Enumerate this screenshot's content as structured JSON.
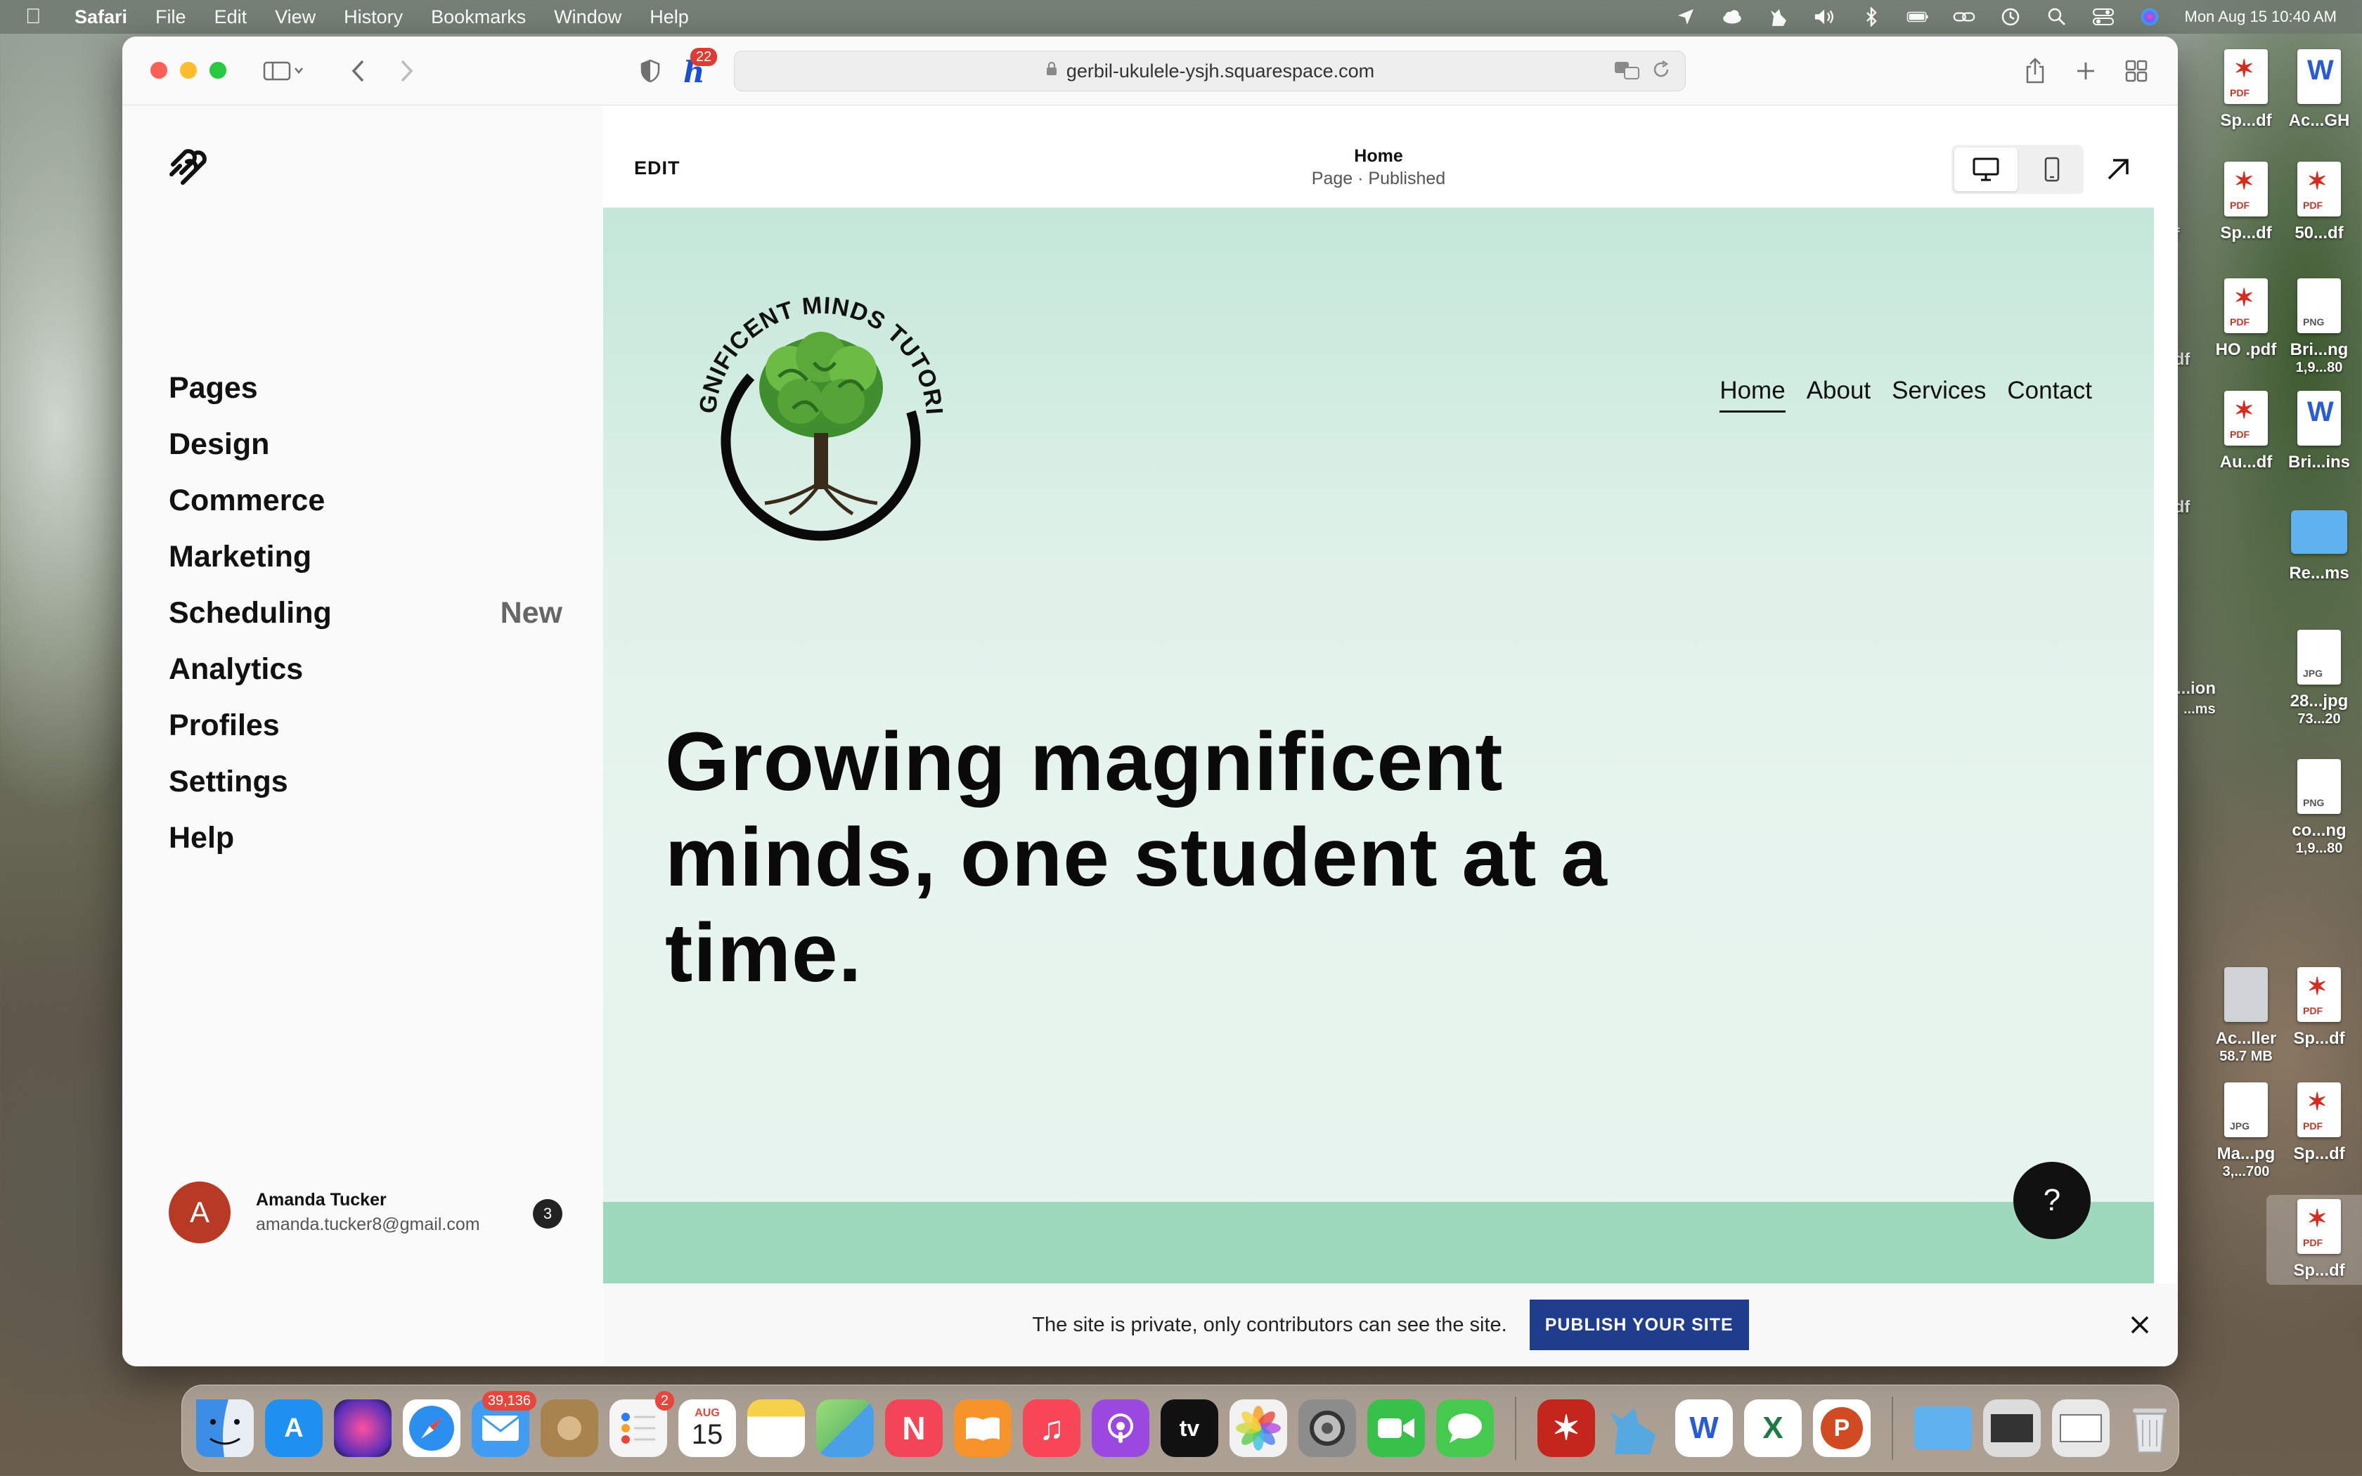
{
  "menubar": {
    "app_name": "Safari",
    "menus": [
      "File",
      "Edit",
      "View",
      "History",
      "Bookmarks",
      "Window",
      "Help"
    ],
    "datetime": "Mon Aug 15  10:40 AM",
    "status_icons": [
      "location-icon",
      "icloud-icon",
      "cat-icon",
      "volume-icon",
      "bluetooth-icon",
      "battery-icon",
      "link-icon",
      "time-machine-icon",
      "search-icon",
      "control-center-icon",
      "siri-icon"
    ]
  },
  "browser": {
    "url": "gerbil-ukulele-ysjh.squarespace.com",
    "extension_badge": "22"
  },
  "sidebar": {
    "items": [
      {
        "label": "Pages"
      },
      {
        "label": "Design"
      },
      {
        "label": "Commerce"
      },
      {
        "label": "Marketing"
      },
      {
        "label": "Scheduling",
        "badge": "New"
      },
      {
        "label": "Analytics"
      },
      {
        "label": "Profiles"
      },
      {
        "label": "Settings"
      },
      {
        "label": "Help"
      }
    ],
    "account": {
      "initial": "A",
      "name": "Amanda Tucker",
      "email": "amanda.tucker8@gmail.com",
      "notifications": "3"
    }
  },
  "editor": {
    "edit_label": "EDIT",
    "page_title": "Home",
    "page_status": "Page · Published"
  },
  "site": {
    "logo_text": "MAGNIFICENT MINDS TUTORING",
    "nav": [
      "Home",
      "About",
      "Services",
      "Contact"
    ],
    "hero": "Growing magnificent minds, one student at a time.",
    "help": "?"
  },
  "banner": {
    "text": "The site is private, only contributors can see the site.",
    "button": "PUBLISH YOUR SITE"
  },
  "desktop_icons": [
    {
      "label": "Sp...df",
      "type": "pdf"
    },
    {
      "label": "Ac...GH",
      "type": "word"
    },
    {
      "label": "Sp...df",
      "type": "pdf"
    },
    {
      "label": "50...df",
      "type": "pdf"
    },
    {
      "label": "HO .pdf",
      "type": "pdf"
    },
    {
      "label": "Bri...ng",
      "sub": "1,9...80",
      "type": "png"
    },
    {
      "label": "Au...df",
      "type": "pdf"
    },
    {
      "label": "Bri...ins",
      "type": "word"
    },
    {
      "label": "Re...ms",
      "type": "folder"
    },
    {
      "label": "28...jpg",
      "sub": "73...20",
      "type": "jpg"
    },
    {
      "label": "co...ng",
      "sub": "1,9...80",
      "type": "png"
    },
    {
      "label": "Ac...ller",
      "sub": "58.7 MB",
      "type": "disk"
    },
    {
      "label": "Sp...df",
      "type": "pdf"
    },
    {
      "label": "Ma...pg",
      "sub": "3,...700",
      "type": "jpg"
    },
    {
      "label": "Sp...df",
      "type": "pdf"
    },
    {
      "label": "Sp...df",
      "type": "pdf"
    }
  ],
  "partial_icons": [
    "df",
    "pdf",
    "pdf",
    "...ion",
    "...ms"
  ],
  "dock": {
    "apps": [
      {
        "name": "Finder",
        "color": "#3b8de6"
      },
      {
        "name": "App Store",
        "color": "#1e90f0"
      },
      {
        "name": "Siri",
        "color": "#5a2fb8"
      },
      {
        "name": "Safari",
        "color": "#2c8ff0"
      },
      {
        "name": "Mail",
        "color": "#3f9cf0",
        "badge": "39,136"
      },
      {
        "name": "Contacts",
        "color": "#a8834e"
      },
      {
        "name": "Reminders",
        "color": "#f5f5f5",
        "badge": "2"
      },
      {
        "name": "Calendar",
        "color": "#ffffff",
        "month": "AUG",
        "day": "15"
      },
      {
        "name": "Notes",
        "color": "#f6d24a"
      },
      {
        "name": "Maps",
        "color": "#6fc36d"
      },
      {
        "name": "News",
        "color": "#f44457"
      },
      {
        "name": "Books",
        "color": "#f6932a"
      },
      {
        "name": "Music",
        "color": "#f84558"
      },
      {
        "name": "Podcasts",
        "color": "#9b48e0"
      },
      {
        "name": "TV",
        "color": "#111111",
        "label": "tv"
      },
      {
        "name": "Photos",
        "color": "#f2f2f2"
      },
      {
        "name": "System Preferences",
        "color": "#8c8c8c"
      },
      {
        "name": "FaceTime",
        "color": "#37c04a"
      },
      {
        "name": "Messages",
        "color": "#46c94f"
      },
      {
        "name": "Acrobat",
        "color": "#c4251c"
      },
      {
        "name": "Cat App",
        "color": "#56a9e0"
      },
      {
        "name": "Word",
        "color": "#2a5bd7",
        "label": "W"
      },
      {
        "name": "Excel",
        "color": "#1d7a45",
        "label": "X"
      },
      {
        "name": "PowerPoint",
        "color": "#d04a22",
        "label": "P"
      },
      {
        "name": "Folder",
        "color": "#5fb1ef"
      },
      {
        "name": "Screenshot 1",
        "color": "#dcdcdc"
      },
      {
        "name": "Screenshot 2",
        "color": "#e8e8e8"
      },
      {
        "name": "Trash",
        "color": "#cfd3d6"
      }
    ]
  }
}
